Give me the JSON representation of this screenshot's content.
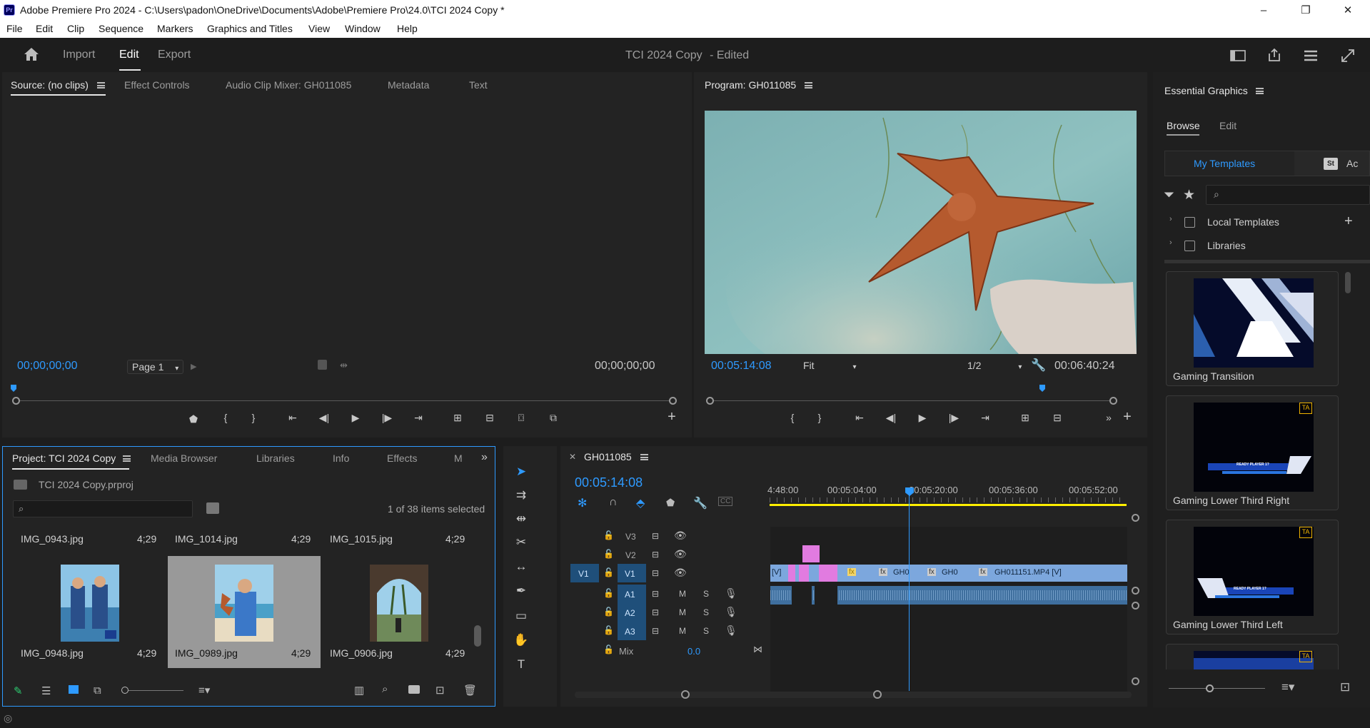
{
  "window": {
    "title": "Adobe Premiere Pro 2024 - C:\\Users\\padon\\OneDrive\\Documents\\Adobe\\Premiere Pro\\24.0\\TCI 2024 Copy *",
    "logo": "Pr",
    "controls": [
      "–",
      "❐",
      "✕"
    ]
  },
  "menu": [
    "File",
    "Edit",
    "Clip",
    "Sequence",
    "Markers",
    "Graphics and Titles",
    "View",
    "Window",
    "Help"
  ],
  "header": {
    "tabs": [
      "Import",
      "Edit",
      "Export"
    ],
    "active_tab": "Edit",
    "project_title": "TCI 2024 Copy",
    "project_status": "- Edited"
  },
  "source_panel": {
    "tabs": [
      "Source: (no clips)",
      "Effect Controls",
      "Audio Clip Mixer: GH011085",
      "Metadata",
      "Text"
    ],
    "timecode_in": "00;00;00;00",
    "timecode_out": "00;00;00;00",
    "page_select": "Page 1"
  },
  "program_panel": {
    "title": "Program: GH011085",
    "timecode": "00:05:14:08",
    "fit": "Fit",
    "resolution": "1/2",
    "duration": "00:06:40:24",
    "playhead_fraction": 0.78
  },
  "essential_graphics": {
    "title": "Essential Graphics",
    "tabs": [
      "Browse",
      "Edit"
    ],
    "my_templates": "My Templates",
    "stock_label": "St",
    "stock_text": "Ac",
    "search_placeholder": "",
    "tree": [
      "Local Templates",
      "Libraries"
    ],
    "templates": [
      "Gaming Transition",
      "Gaming Lower Third Right",
      "Gaming Lower Third Left"
    ],
    "card_text": [
      "READY PLAYER 1?",
      "READY PLAYER 1?"
    ]
  },
  "project_panel": {
    "tabs": [
      "Project: TCI 2024 Copy",
      "Media Browser",
      "Libraries",
      "Info",
      "Effects",
      "M"
    ],
    "file": "TCI 2024 Copy.prproj",
    "selection": "1 of 38 items selected",
    "search_placeholder": "",
    "items_row1": [
      {
        "name": "IMG_0943.jpg",
        "duration": "4;29"
      },
      {
        "name": "IMG_1014.jpg",
        "duration": "4;29"
      },
      {
        "name": "IMG_1015.jpg",
        "duration": "4;29"
      }
    ],
    "items_row2": [
      {
        "name": "IMG_0948.jpg",
        "duration": "4;29"
      },
      {
        "name": "IMG_0989.jpg",
        "duration": "4;29"
      },
      {
        "name": "IMG_0906.jpg",
        "duration": "4;29"
      }
    ]
  },
  "timeline": {
    "sequence": "GH011085",
    "timecode": "00:05:14:08",
    "ruler": [
      "4:48:00",
      "00:05:04:00",
      "00:05:20:00",
      "00:05:36:00",
      "00:05:52:00"
    ],
    "tracks_video": [
      "V3",
      "V2",
      "V1"
    ],
    "tracks_audio": [
      "A1",
      "A2",
      "A3"
    ],
    "source_patch_video": "V1",
    "track_letters": [
      "M",
      "S"
    ],
    "mix_label": "Mix",
    "mix_value": "0.0",
    "clips": {
      "clip_a": "[V]",
      "clip_b": "GH0",
      "clip_c": "GH0",
      "clip_d": "GH011151.MP4 [V]",
      "fx": "fx"
    }
  },
  "colors": {
    "accent_blue": "#2e9aff",
    "clip_video": "#7ca7dd",
    "clip_pink": "#e17be0",
    "work_area": "#ffee00"
  }
}
